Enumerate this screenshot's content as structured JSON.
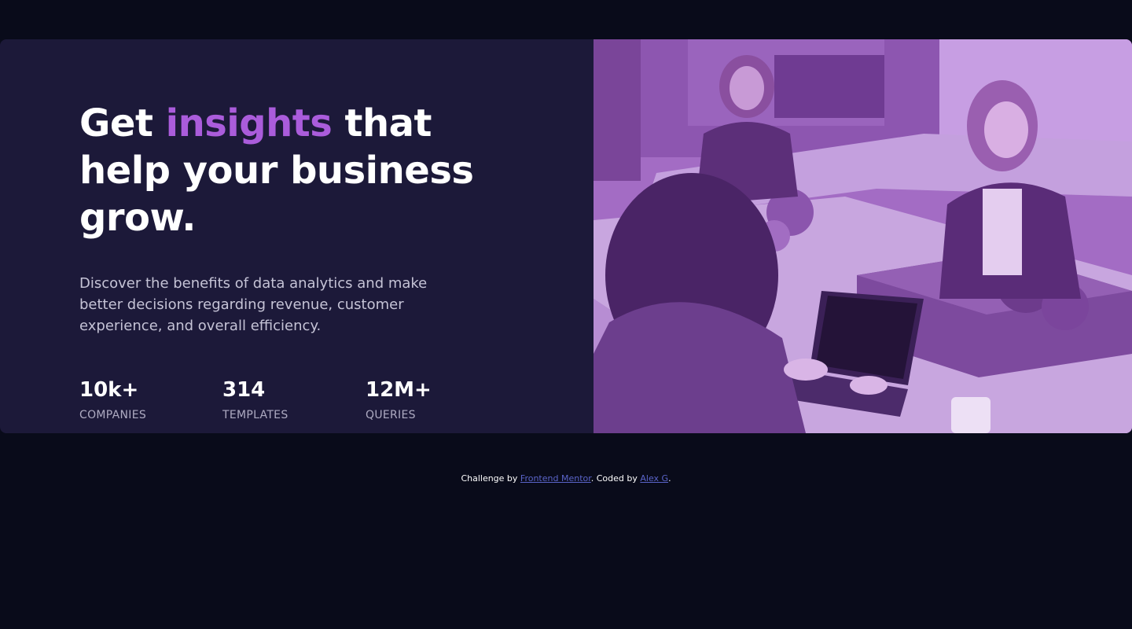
{
  "hero": {
    "headline_before": "Get ",
    "headline_accent": "insights",
    "headline_after": " that help your business grow.",
    "description": "Discover the benefits of data analytics and make better decisions regarding revenue, customer experience, and overall efficiency.",
    "stats": [
      {
        "value": "10k+",
        "label": "COMPANIES"
      },
      {
        "value": "314",
        "label": "TEMPLATES"
      },
      {
        "value": "12M+",
        "label": "QUERIES"
      }
    ]
  },
  "image": {
    "description": "Women working at desks in an office, tinted purple"
  },
  "footer": {
    "prefix": "Challenge by ",
    "challenge_link": "Frontend Mentor",
    "middle": ". Coded by ",
    "author_link": "Alex G",
    "suffix": "."
  },
  "colors": {
    "page_background": "#090b1a",
    "card_background": "#1c1939",
    "accent": "#aa5cdb",
    "image_tint": "#9c63bd",
    "link": "#5a64c9"
  }
}
